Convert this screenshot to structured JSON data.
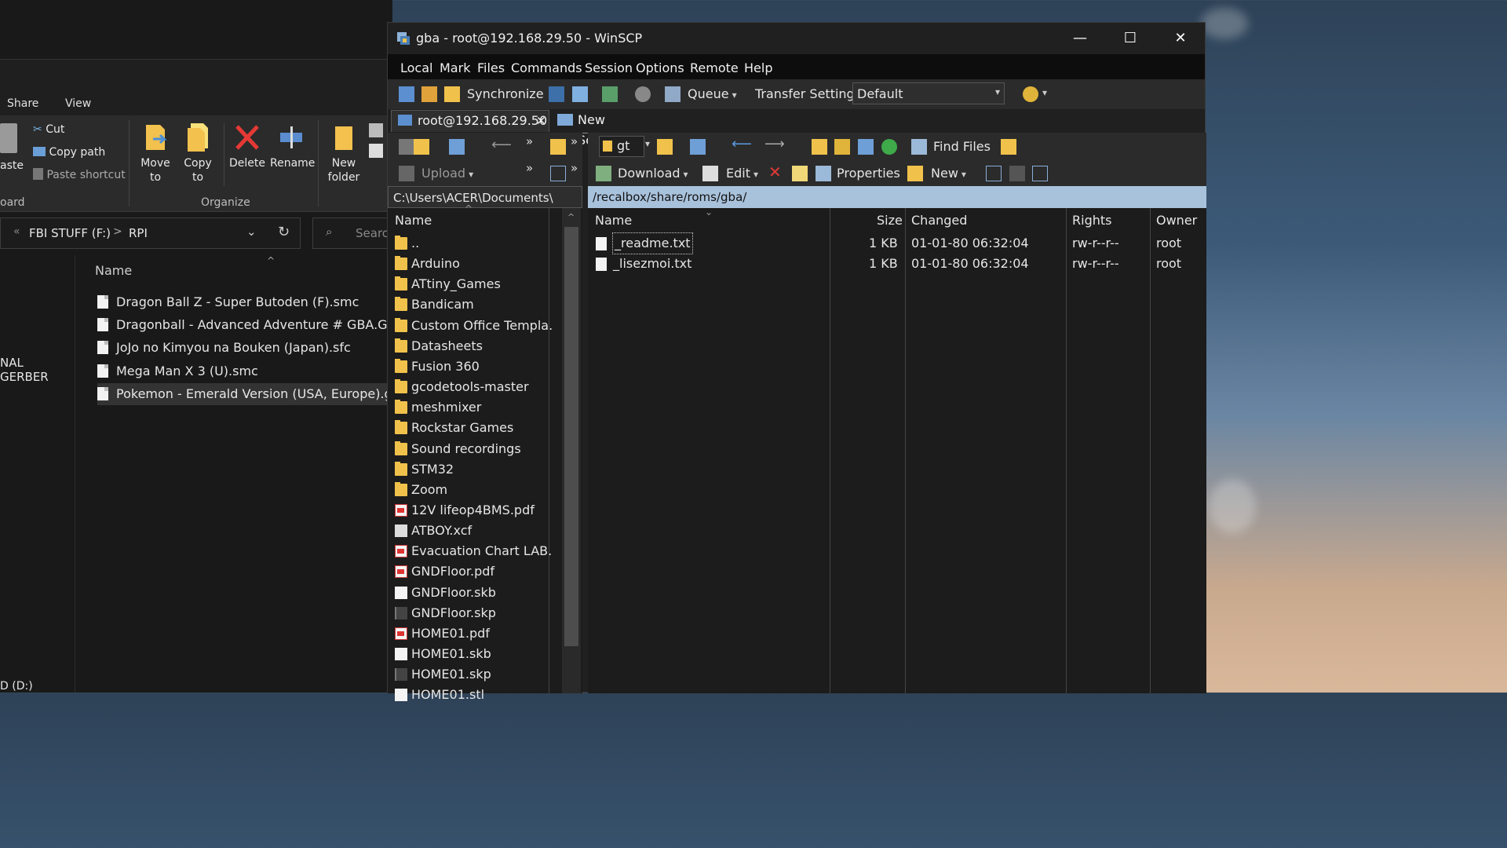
{
  "explorer": {
    "tabs": [
      "Share",
      "View"
    ],
    "clipboard": {
      "paste_label": "aste",
      "cut_label": "Cut",
      "copy_path_label": "Copy path",
      "paste_shortcut_label": "Paste shortcut",
      "group_label": "oard"
    },
    "organize": {
      "move_to_label": "Move\nto",
      "copy_to_label": "Copy\nto",
      "delete_label": "Delete",
      "rename_label": "Rename",
      "group_label": "Organize"
    },
    "new_folder_label": "New\nfolder",
    "address": {
      "drive": "FBI STUFF (F:)",
      "folder": "RPI",
      "sep1": "«",
      "sep2": ">"
    },
    "search_placeholder": "Search",
    "column_name": "Name",
    "nav_items": [
      "NAL GERBER",
      "D (D:)"
    ],
    "files": [
      "Dragon Ball Z - Super Butoden (F).smc",
      "Dragonball - Advanced Adventure # GBA.GBA",
      "JoJo no Kimyou na Bouken (Japan).sfc",
      "Mega Man X 3 (U).smc",
      "Pokemon - Emerald Version (USA, Europe).gba"
    ]
  },
  "winscp": {
    "title": "gba - root@192.168.29.50 - WinSCP",
    "window_controls": {
      "minimize": "—",
      "maximize": "☐",
      "close": "✕"
    },
    "menu": [
      "Local",
      "Mark",
      "Files",
      "Commands",
      "Session",
      "Options",
      "Remote",
      "Help"
    ],
    "toolbar": {
      "synchronize": "Synchronize",
      "queue": "Queue",
      "transfer_settings": "Transfer Settings",
      "transfer_preset": "Default"
    },
    "sessions": {
      "active": "root@192.168.29.50",
      "new": "New Session"
    },
    "local_tools": {
      "upload": "Upload"
    },
    "remote_tools": {
      "drive": "gt",
      "find_files": "Find Files",
      "download": "Download",
      "edit": "Edit",
      "properties": "Properties",
      "new": "New"
    },
    "local_path": "C:\\Users\\ACER\\Documents\\",
    "remote_path": "/recalbox/share/roms/gba/",
    "local_columns": {
      "name": "Name"
    },
    "remote_columns": {
      "name": "Name",
      "size": "Size",
      "changed": "Changed",
      "rights": "Rights",
      "owner": "Owner"
    },
    "local_files": [
      {
        "name": "..",
        "type": "up"
      },
      {
        "name": "Arduino",
        "type": "folder"
      },
      {
        "name": "ATtiny_Games",
        "type": "folder"
      },
      {
        "name": "Bandicam",
        "type": "folder"
      },
      {
        "name": "Custom Office Templa...",
        "type": "folder"
      },
      {
        "name": "Datasheets",
        "type": "folder"
      },
      {
        "name": "Fusion 360",
        "type": "folder"
      },
      {
        "name": "gcodetools-master",
        "type": "folder"
      },
      {
        "name": "meshmixer",
        "type": "folder"
      },
      {
        "name": "Rockstar Games",
        "type": "folder"
      },
      {
        "name": "Sound recordings",
        "type": "folder"
      },
      {
        "name": "STM32",
        "type": "folder"
      },
      {
        "name": "Zoom",
        "type": "folder"
      },
      {
        "name": "12V lifeop4BMS.pdf",
        "type": "pdf"
      },
      {
        "name": "ATBOY.xcf",
        "type": "xcf"
      },
      {
        "name": "Evacuation Chart LAB...",
        "type": "pdf"
      },
      {
        "name": "GNDFloor.pdf",
        "type": "pdf"
      },
      {
        "name": "GNDFloor.skb",
        "type": "file"
      },
      {
        "name": "GNDFloor.skp",
        "type": "skp"
      },
      {
        "name": "HOME01.pdf",
        "type": "pdf"
      },
      {
        "name": "HOME01.skb",
        "type": "file"
      },
      {
        "name": "HOME01.skp",
        "type": "skp"
      },
      {
        "name": "HOME01.stl",
        "type": "file"
      }
    ],
    "remote_files": [
      {
        "name": "_readme.txt",
        "size": "1 KB",
        "changed": "01-01-80 06:32:04",
        "rights": "rw-r--r--",
        "owner": "root"
      },
      {
        "name": "_lisezmoi.txt",
        "size": "1 KB",
        "changed": "01-01-80 06:32:04",
        "rights": "rw-r--r--",
        "owner": "root"
      }
    ]
  }
}
